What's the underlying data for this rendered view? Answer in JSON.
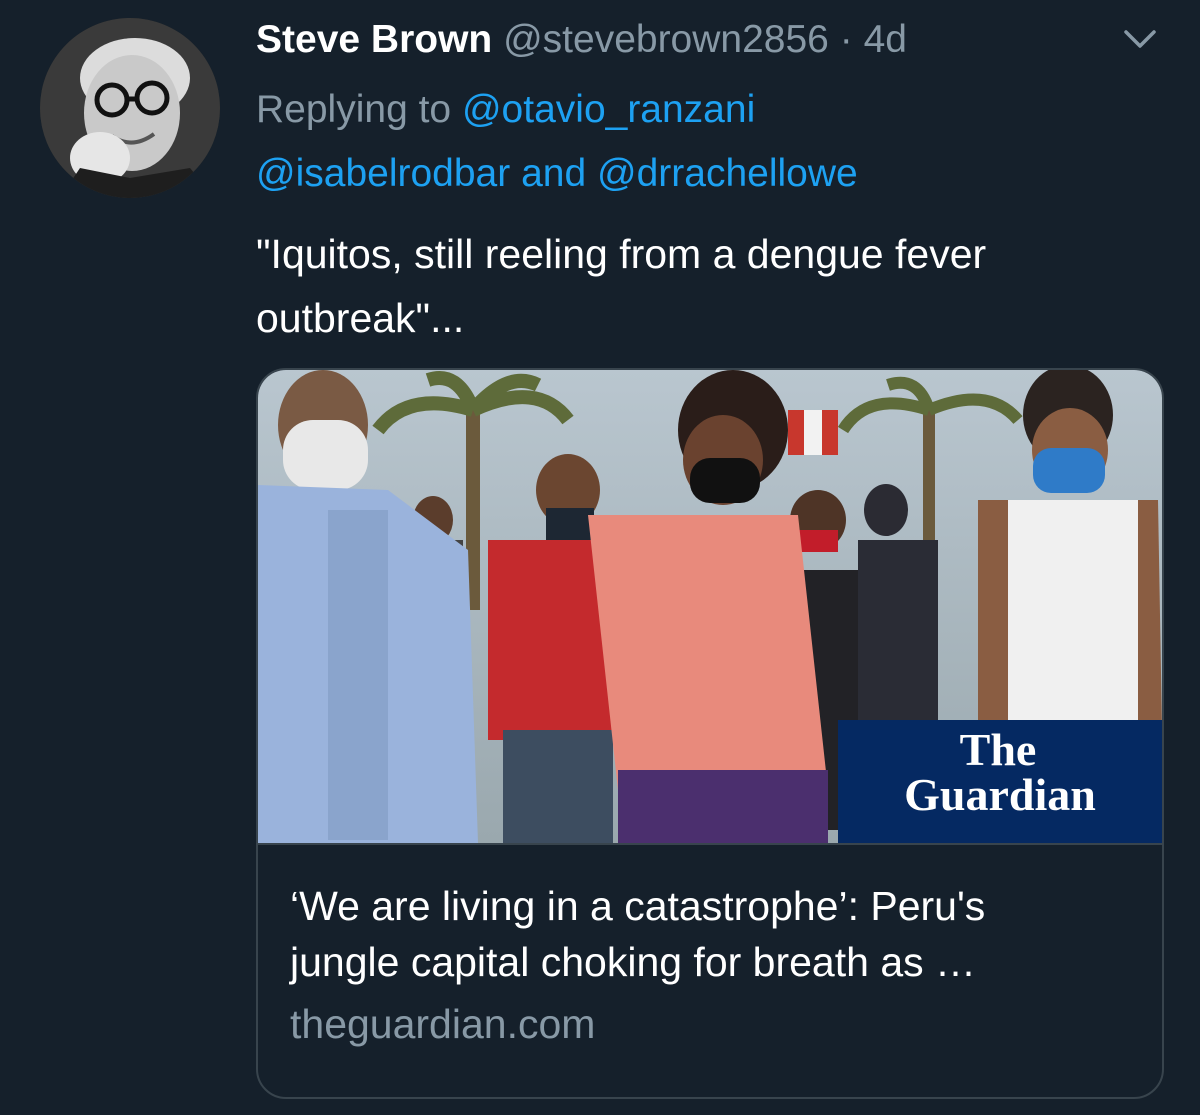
{
  "tweet": {
    "author_name": "Steve Brown",
    "author_handle": "@stevebrown2856",
    "separator": "·",
    "time": "4d",
    "replying_prefix": "Replying to",
    "mentions": [
      "@otavio_ranzani",
      "@isabelrodbar",
      "@drrachellowe"
    ],
    "mention_joiner": "and",
    "text_line1": "\"Iquitos, still reeling from a dengue fever",
    "text_line2": "outbreak\"...",
    "menu_icon": "chevron-down-icon",
    "avatar_icon": "avatar"
  },
  "card": {
    "title_line1": "‘We are living in a catastrophe’: Peru's",
    "title_line2": "jungle capital choking for breath as …",
    "domain": "theguardian.com",
    "logo_line1": "The",
    "logo_line2": "Guardian",
    "logo_bg": "#052962"
  },
  "colors": {
    "background": "#15202b",
    "secondary_text": "#8899a6",
    "link": "#1da1f2",
    "border": "#38444d"
  }
}
